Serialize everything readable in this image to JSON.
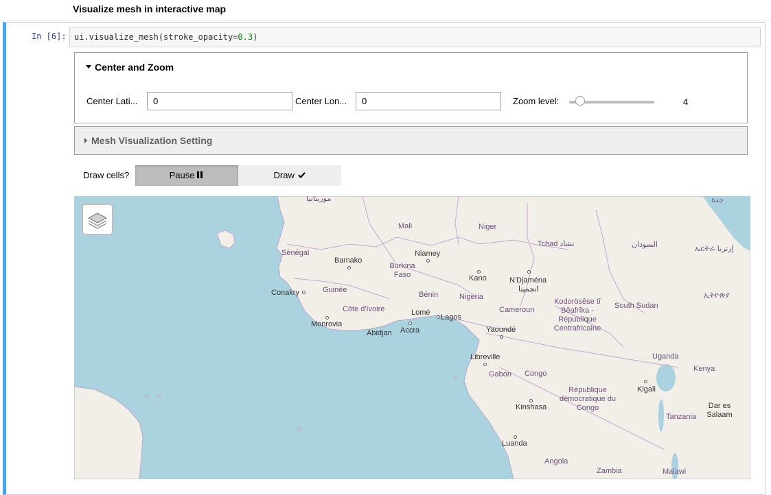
{
  "notebook": {
    "heading": "Visualize mesh in interactive map",
    "prompt": "In [6]:",
    "code_fn": "ui.visualize_mesh(stroke_opacity=",
    "code_num": "0.3",
    "code_end": ")"
  },
  "center_zoom": {
    "title": "Center and Zoom",
    "lat_label": "Center Lati...",
    "lat_value": "0",
    "lon_label": "Center Lon...",
    "lon_value": "0",
    "zoom_label": "Zoom level:",
    "zoom_value": "4"
  },
  "mesh_setting": {
    "title": "Mesh Visualization Setting"
  },
  "draw_cells": {
    "label": "Draw cells?",
    "options": [
      {
        "label": "Pause",
        "icon": "pause-icon",
        "selected": true
      },
      {
        "label": "Draw",
        "icon": "check-icon",
        "selected": false
      }
    ]
  },
  "map": {
    "layers_icon": "layers-icon",
    "countries": [
      "موريتانيا",
      "Mali",
      "Niger",
      "Tchad تشاد",
      "السودان",
      "ኤርትራ إرتريا",
      "جدة",
      "Sénégal",
      "Burkina Faso",
      "Guinée",
      "Bénin",
      "Nigeria",
      "Côte d'Ivoire",
      "Cameroun",
      "Kodorösêse tî Bêafrîka - République Centrafricaine",
      "South Sudan",
      "ኢትዮጵያ",
      "Gabon",
      "Congo",
      "Uganda",
      "Kenya",
      "République démocratique du Congo",
      "Tanzania",
      "Angola",
      "Zambia",
      "Malawi"
    ],
    "cities": [
      "Bamako",
      "Niamey",
      "Kano",
      "N'Djaména",
      "انجمينا",
      "Conakry",
      "Monrovia",
      "Abidjan",
      "Accra",
      "Lomé",
      "Lagos",
      "Yaoundé",
      "Libreville",
      "Kigali",
      "Kinshasa",
      "Dar es Salaam",
      "Luanda"
    ]
  }
}
